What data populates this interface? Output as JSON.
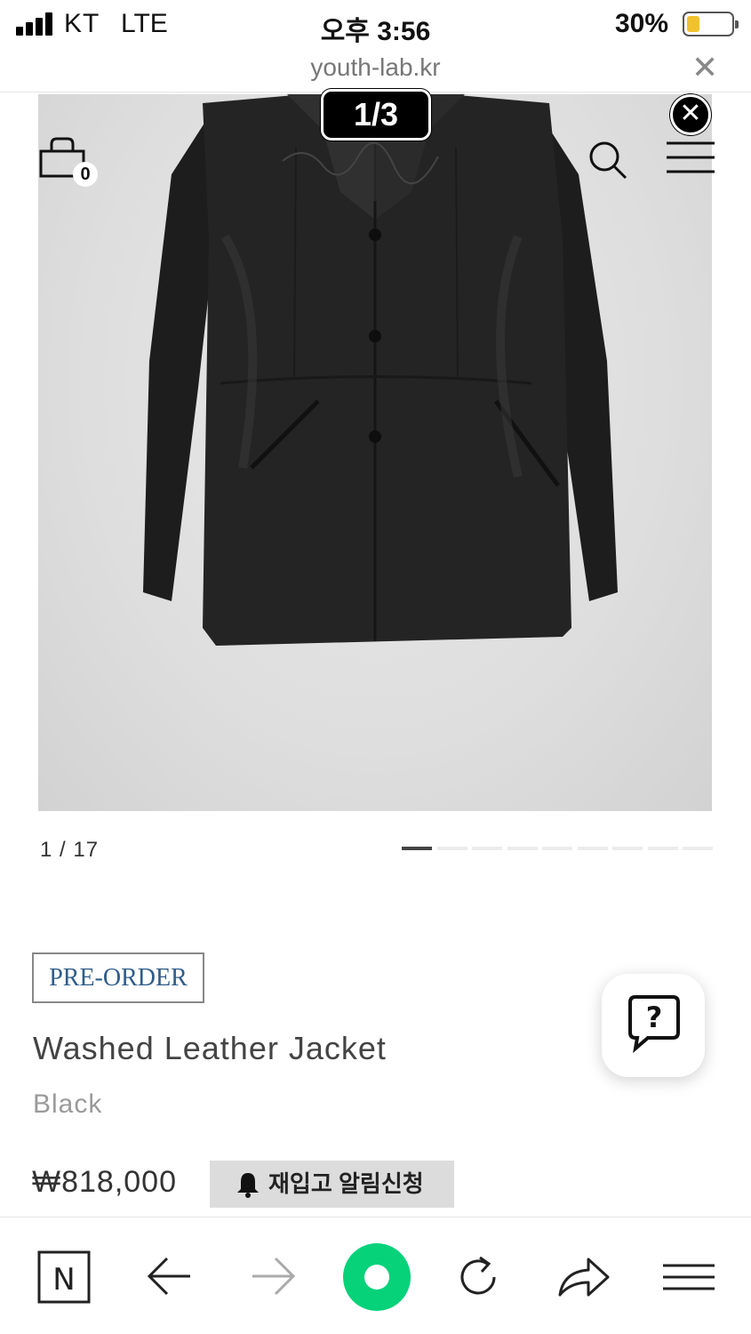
{
  "status_bar": {
    "carrier": "KT",
    "network": "LTE",
    "time": "오후 3:56",
    "battery_percent": "30%",
    "battery_level": 0.3,
    "battery_color": "#f2c12e"
  },
  "url_bar": {
    "url": "youth-lab.kr",
    "close_icon": "close-icon"
  },
  "image_viewer": {
    "counter": "1/3",
    "close_icon": "close-circle-icon"
  },
  "header_icons": {
    "cart_count": "0",
    "cart_icon": "shopping-bag-icon",
    "search_icon": "search-icon",
    "menu_icon": "hamburger-menu-icon"
  },
  "slider": {
    "counter": "1 / 17",
    "dot_count": 9,
    "active_index": 0
  },
  "product": {
    "badge": "PRE-ORDER",
    "name": "Washed Leather Jacket",
    "color": "Black",
    "price": "₩818,000",
    "restock_label": "재입고 알림신청",
    "restock_icon": "bell-icon"
  },
  "help_button": {
    "icon": "question-chat-icon"
  },
  "bottom_toolbar": {
    "items": [
      "naver-n-icon",
      "back-arrow-icon",
      "forward-arrow-icon",
      "green-home-icon",
      "reload-icon",
      "share-icon",
      "menu-icon"
    ],
    "accent": "#06d27a"
  }
}
